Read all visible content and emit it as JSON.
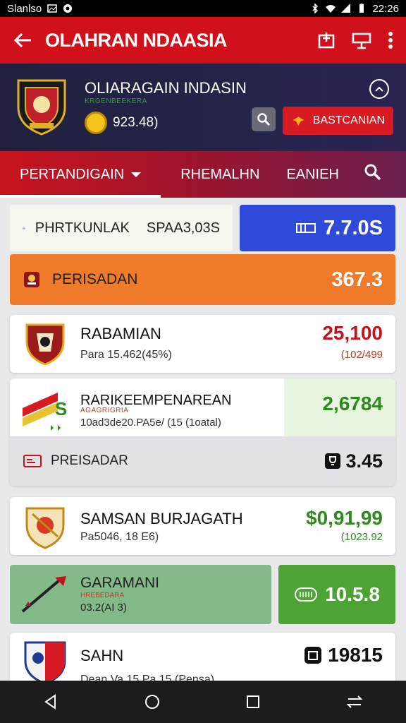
{
  "status": {
    "carrier": "Slanlso",
    "time": "22:26"
  },
  "appbar": {
    "title": "OLAHRAN NDAASIA"
  },
  "team": {
    "name": "OLIARAGAIN INDASIN",
    "subtitle": "KRGENBEEKERA",
    "count": "923.48)",
    "button_label": "BASTCANIAN"
  },
  "tabs": [
    {
      "label": "PERTANDIGAIN"
    },
    {
      "label": "RHEMALHN"
    },
    {
      "label": "EANIEH"
    }
  ],
  "rows": {
    "strip1": {
      "left_label": "PHRTKUNLAK",
      "left_value": "SPAA3,03S",
      "right_value": "7.7.0S"
    },
    "orange": {
      "label": "PERISADAN",
      "value": "367.3"
    },
    "item1": {
      "name": "RABAMIAN",
      "sub": "Para 15.462(45%)",
      "value": "25,100",
      "value2": "(102/499"
    },
    "item2": {
      "name": "RARIKEEMPENAREAN",
      "tag": "AGAGRIGRIA",
      "sub": "10ad3de20.PA5e/ (15 (1oatal)",
      "value": "2,6784",
      "sub_label": "PREISADAR",
      "sub_value": "3.45"
    },
    "item3": {
      "name": "SAMSAN BURJAGATH",
      "sub": "Pa5046, 18 E6)",
      "value": "$0,91,99",
      "value2": "(1023.92"
    },
    "item4": {
      "name": "GARAMANI",
      "tag": "HREBEDARA",
      "sub": "03.2(AI 3)",
      "value": "10.5.8"
    },
    "item5": {
      "name": "SAHN",
      "value": "19815",
      "sub": "Dean Va 15 Pa 15 (Pensa)"
    }
  },
  "colors": {
    "red": "#d0101b",
    "navy": "#22224a",
    "blue": "#2e4ad6",
    "orange": "#ef7a2a",
    "green": "#4ea335",
    "value_red": "#c0151f",
    "value_green": "#2e8a1e"
  }
}
